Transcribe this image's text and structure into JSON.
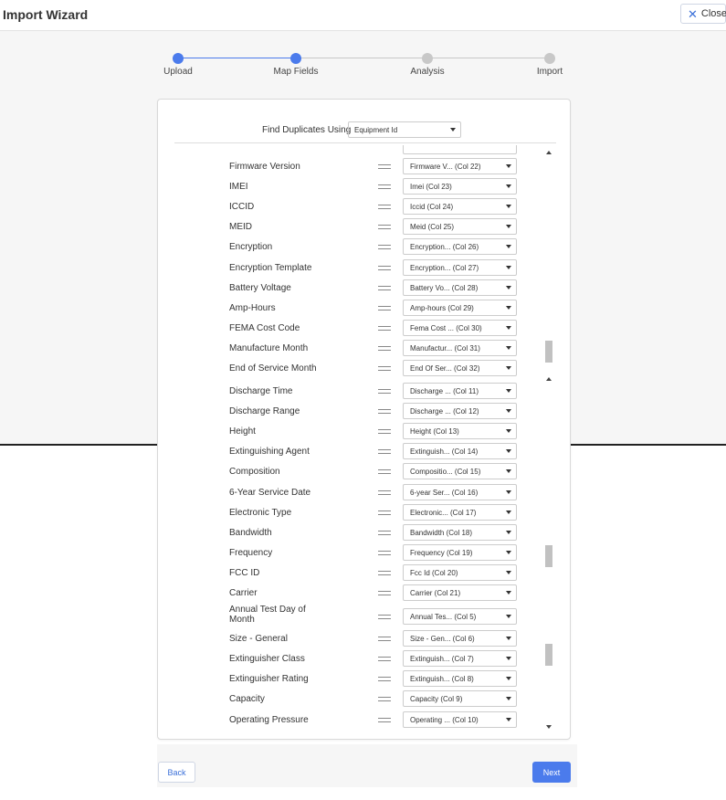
{
  "header": {
    "title": "Import Wizard",
    "close_label": "Close"
  },
  "stepper": {
    "steps": [
      {
        "label": "Upload",
        "state": "done"
      },
      {
        "label": "Map Fields",
        "state": "active"
      },
      {
        "label": "Analysis",
        "state": "pending"
      },
      {
        "label": "Import",
        "state": "pending"
      }
    ],
    "colors": {
      "active": "#4b7bec",
      "pending": "#c8c8c8"
    }
  },
  "find_duplicates": {
    "label": "Find Duplicates Using",
    "value": "Equipment Id"
  },
  "fields_top": [
    {
      "label": "Firmware Version",
      "mapped": "Firmware V... (Col 22)"
    },
    {
      "label": "IMEI",
      "mapped": "Imei (Col 23)"
    },
    {
      "label": "ICCID",
      "mapped": "Iccid (Col 24)"
    },
    {
      "label": "MEID",
      "mapped": "Meid (Col 25)"
    },
    {
      "label": "Encryption",
      "mapped": "Encryption... (Col 26)"
    },
    {
      "label": "Encryption Template",
      "mapped": "Encryption... (Col 27)"
    },
    {
      "label": "Battery Voltage",
      "mapped": "Battery Vo... (Col 28)"
    },
    {
      "label": "Amp-Hours",
      "mapped": "Amp-hours (Col 29)"
    },
    {
      "label": "FEMA Cost Code",
      "mapped": "Fema Cost ... (Col 30)"
    },
    {
      "label": "Manufacture Month",
      "mapped": "Manufactur... (Col 31)"
    },
    {
      "label": "End of Service Month",
      "mapped": "End Of Ser... (Col 32)"
    }
  ],
  "fields_bottom": [
    {
      "label": "Discharge Time",
      "mapped": "Discharge ... (Col 11)"
    },
    {
      "label": "Discharge Range",
      "mapped": "Discharge ... (Col 12)"
    },
    {
      "label": "Height",
      "mapped": "Height (Col 13)"
    },
    {
      "label": "Extinguishing Agent",
      "mapped": "Extinguish... (Col 14)"
    },
    {
      "label": "Composition",
      "mapped": "Compositio... (Col 15)"
    },
    {
      "label": "6-Year Service Date",
      "mapped": "6-year Ser... (Col 16)"
    },
    {
      "label": "Electronic Type",
      "mapped": "Electronic... (Col 17)"
    },
    {
      "label": "Bandwidth",
      "mapped": "Bandwidth (Col 18)"
    },
    {
      "label": "Frequency",
      "mapped": "Frequency (Col 19)"
    },
    {
      "label": "FCC ID",
      "mapped": "Fcc Id (Col 20)"
    },
    {
      "label": "Carrier",
      "mapped": "Carrier (Col 21)"
    },
    {
      "label": "Annual Test Day of Month",
      "mapped": "Annual Tes... (Col 5)"
    },
    {
      "label": "Size - General",
      "mapped": "Size - Gen... (Col 6)"
    },
    {
      "label": "Extinguisher Class",
      "mapped": "Extinguish... (Col 7)"
    },
    {
      "label": "Extinguisher Rating",
      "mapped": "Extinguish... (Col 8)"
    },
    {
      "label": "Capacity",
      "mapped": "Capacity (Col 9)"
    },
    {
      "label": "Operating Pressure",
      "mapped": "Operating ... (Col 10)"
    }
  ],
  "footer": {
    "back_label": "Back",
    "next_label": "Next"
  }
}
